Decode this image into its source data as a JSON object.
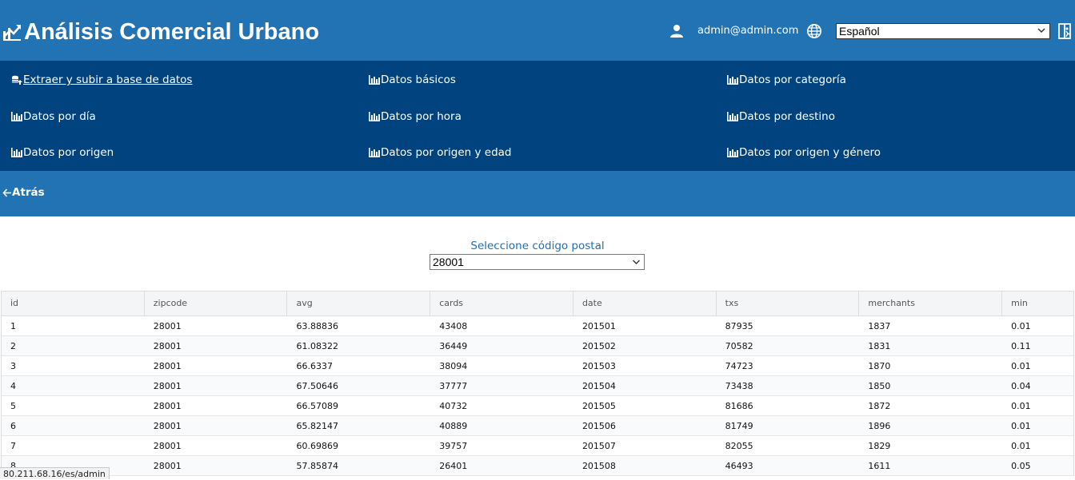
{
  "header": {
    "title": "Análisis Comercial Urbano",
    "user_email": "admin@admin.com",
    "language": "Español"
  },
  "menu": {
    "items": [
      {
        "label": "Extraer y subir a base de datos",
        "icon": "database-upload-icon"
      },
      {
        "label": "Datos básicos",
        "icon": "bar-chart-icon"
      },
      {
        "label": "Datos por categoría",
        "icon": "bar-chart-icon"
      },
      {
        "label": "Datos por día",
        "icon": "bar-chart-icon"
      },
      {
        "label": "Datos por hora",
        "icon": "bar-chart-icon"
      },
      {
        "label": "Datos por destino",
        "icon": "bar-chart-icon"
      },
      {
        "label": "Datos por origen",
        "icon": "bar-chart-icon"
      },
      {
        "label": "Datos por origen y edad",
        "icon": "bar-chart-icon"
      },
      {
        "label": "Datos por origen y género",
        "icon": "bar-chart-icon"
      }
    ]
  },
  "subbar": {
    "back_label": "Atrás"
  },
  "filter": {
    "label": "Seleccione código postal",
    "selected": "28001"
  },
  "table": {
    "columns": [
      "id",
      "zipcode",
      "avg",
      "cards",
      "date",
      "txs",
      "merchants",
      "min"
    ],
    "rows": [
      [
        "1",
        "28001",
        "63.88836",
        "43408",
        "201501",
        "87935",
        "1837",
        "0.01"
      ],
      [
        "2",
        "28001",
        "61.08322",
        "36449",
        "201502",
        "70582",
        "1831",
        "0.11"
      ],
      [
        "3",
        "28001",
        "66.6337",
        "38094",
        "201503",
        "74723",
        "1870",
        "0.01"
      ],
      [
        "4",
        "28001",
        "67.50646",
        "37777",
        "201504",
        "73438",
        "1850",
        "0.04"
      ],
      [
        "5",
        "28001",
        "66.57089",
        "40732",
        "201505",
        "81686",
        "1872",
        "0.01"
      ],
      [
        "6",
        "28001",
        "65.82147",
        "40889",
        "201506",
        "81749",
        "1896",
        "0.01"
      ],
      [
        "7",
        "28001",
        "60.69869",
        "39757",
        "201507",
        "82055",
        "1829",
        "0.01"
      ],
      [
        "8",
        "28001",
        "57.85874",
        "26401",
        "201508",
        "46493",
        "1611",
        "0.05"
      ]
    ]
  },
  "status": {
    "url": "80.211.68.16/es/admin"
  }
}
